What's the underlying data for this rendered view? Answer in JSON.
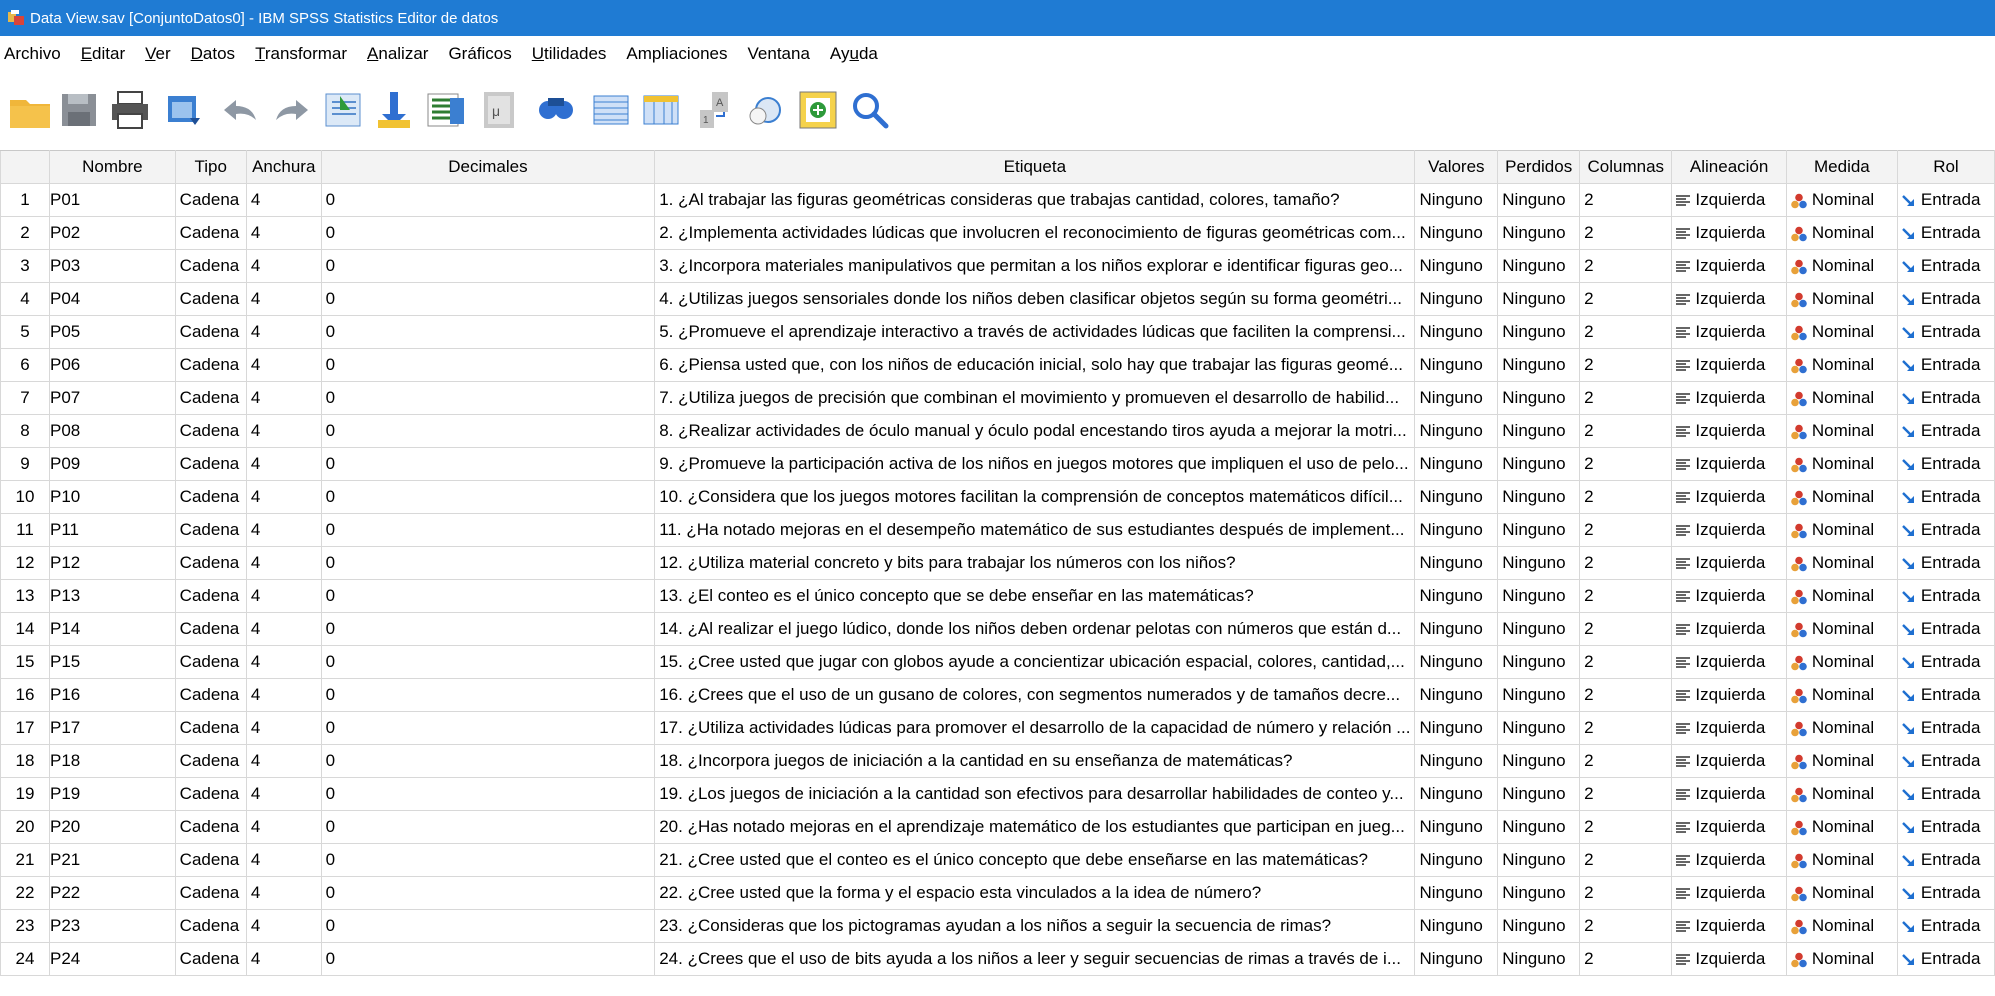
{
  "window": {
    "title": "Data View.sav [ConjuntoDatos0] - IBM SPSS Statistics Editor de datos"
  },
  "menu": [
    {
      "label": "Archivo",
      "accel": ""
    },
    {
      "label": "Editar",
      "accel": "E"
    },
    {
      "label": "Ver",
      "accel": "V"
    },
    {
      "label": "Datos",
      "accel": "D"
    },
    {
      "label": "Transformar",
      "accel": "T"
    },
    {
      "label": "Analizar",
      "accel": "A"
    },
    {
      "label": "Gráficos",
      "accel": ""
    },
    {
      "label": "Utilidades",
      "accel": "U"
    },
    {
      "label": "Ampliaciones",
      "accel": ""
    },
    {
      "label": "Ventana",
      "accel": ""
    },
    {
      "label": "Ayuda",
      "accel": "u"
    }
  ],
  "toolbar": [
    "open-folder-icon",
    "save-icon",
    "print-icon",
    "dialog-recall-icon",
    "undo-icon",
    "redo-icon",
    "go-to-case-icon",
    "go-to-variable-icon",
    "variables-icon",
    "run-descriptives-icon",
    "find-icon",
    "insert-cases-icon",
    "insert-variable-icon",
    "split-file-icon",
    "weight-cases-icon",
    "select-cases-icon",
    "search-icon"
  ],
  "colors": {
    "titlebar": "#1f7bd3",
    "header": "#f3f3f3",
    "nominal_red": "#c0392b",
    "entrada_blue": "#1e6fd0"
  },
  "grid": {
    "headers": [
      "Nombre",
      "Tipo",
      "Anchura",
      "Decimales",
      "Etiqueta",
      "Valores",
      "Perdidos",
      "Columnas",
      "Alineación",
      "Medida",
      "Rol"
    ],
    "rows": [
      {
        "n": "1",
        "nombre": "P01",
        "tipo": "Cadena",
        "anchura": "4",
        "decimales": "0",
        "etiqueta": "1. ¿Al trabajar las figuras geométricas consideras que trabajas cantidad, colores, tamaño?",
        "valores": "Ninguno",
        "perdidos": "Ninguno",
        "columnas": "2",
        "alineacion": "Izquierda",
        "medida": "Nominal",
        "rol": "Entrada"
      },
      {
        "n": "2",
        "nombre": "P02",
        "tipo": "Cadena",
        "anchura": "4",
        "decimales": "0",
        "etiqueta": "2. ¿Implementa actividades lúdicas que involucren el reconocimiento de figuras geométricas com...",
        "valores": "Ninguno",
        "perdidos": "Ninguno",
        "columnas": "2",
        "alineacion": "Izquierda",
        "medida": "Nominal",
        "rol": "Entrada"
      },
      {
        "n": "3",
        "nombre": "P03",
        "tipo": "Cadena",
        "anchura": "4",
        "decimales": "0",
        "etiqueta": "3. ¿Incorpora materiales manipulativos que permitan a los niños explorar e identificar figuras geo...",
        "valores": "Ninguno",
        "perdidos": "Ninguno",
        "columnas": "2",
        "alineacion": "Izquierda",
        "medida": "Nominal",
        "rol": "Entrada"
      },
      {
        "n": "4",
        "nombre": "P04",
        "tipo": "Cadena",
        "anchura": "4",
        "decimales": "0",
        "etiqueta": "4. ¿Utilizas juegos sensoriales donde los niños deben clasificar objetos según su forma geométri...",
        "valores": "Ninguno",
        "perdidos": "Ninguno",
        "columnas": "2",
        "alineacion": "Izquierda",
        "medida": "Nominal",
        "rol": "Entrada"
      },
      {
        "n": "5",
        "nombre": "P05",
        "tipo": "Cadena",
        "anchura": "4",
        "decimales": "0",
        "etiqueta": "5. ¿Promueve el aprendizaje interactivo a través de actividades lúdicas que faciliten la comprensi...",
        "valores": "Ninguno",
        "perdidos": "Ninguno",
        "columnas": "2",
        "alineacion": "Izquierda",
        "medida": "Nominal",
        "rol": "Entrada"
      },
      {
        "n": "6",
        "nombre": "P06",
        "tipo": "Cadena",
        "anchura": "4",
        "decimales": "0",
        "etiqueta": "6. ¿Piensa usted que, con los niños de educación inicial, solo hay que trabajar las figuras geomé...",
        "valores": "Ninguno",
        "perdidos": "Ninguno",
        "columnas": "2",
        "alineacion": "Izquierda",
        "medida": "Nominal",
        "rol": "Entrada"
      },
      {
        "n": "7",
        "nombre": "P07",
        "tipo": "Cadena",
        "anchura": "4",
        "decimales": "0",
        "etiqueta": "7. ¿Utiliza juegos de precisión que combinan el movimiento   y promueven el desarrollo de habilid...",
        "valores": "Ninguno",
        "perdidos": "Ninguno",
        "columnas": "2",
        "alineacion": "Izquierda",
        "medida": "Nominal",
        "rol": "Entrada"
      },
      {
        "n": "8",
        "nombre": "P08",
        "tipo": "Cadena",
        "anchura": "4",
        "decimales": "0",
        "etiqueta": "8. ¿Realizar actividades de óculo manual y óculo podal encestando tiros ayuda a mejorar la motri...",
        "valores": "Ninguno",
        "perdidos": "Ninguno",
        "columnas": "2",
        "alineacion": "Izquierda",
        "medida": "Nominal",
        "rol": "Entrada"
      },
      {
        "n": "9",
        "nombre": "P09",
        "tipo": "Cadena",
        "anchura": "4",
        "decimales": "0",
        "etiqueta": "9. ¿Promueve la participación activa de los niños en juegos motores que impliquen el uso de pelo...",
        "valores": "Ninguno",
        "perdidos": "Ninguno",
        "columnas": "2",
        "alineacion": "Izquierda",
        "medida": "Nominal",
        "rol": "Entrada"
      },
      {
        "n": "10",
        "nombre": "P10",
        "tipo": "Cadena",
        "anchura": "4",
        "decimales": "0",
        "etiqueta": "10. ¿Considera que los juegos motores facilitan la comprensión de conceptos matemáticos difícil...",
        "valores": "Ninguno",
        "perdidos": "Ninguno",
        "columnas": "2",
        "alineacion": "Izquierda",
        "medida": "Nominal",
        "rol": "Entrada"
      },
      {
        "n": "11",
        "nombre": "P11",
        "tipo": "Cadena",
        "anchura": "4",
        "decimales": "0",
        "etiqueta": "11. ¿Ha notado mejoras en el desempeño matemático de sus estudiantes después de implement...",
        "valores": "Ninguno",
        "perdidos": "Ninguno",
        "columnas": "2",
        "alineacion": "Izquierda",
        "medida": "Nominal",
        "rol": "Entrada"
      },
      {
        "n": "12",
        "nombre": "P12",
        "tipo": "Cadena",
        "anchura": "4",
        "decimales": "0",
        "etiqueta": "12. ¿Utiliza material concreto y bits para trabajar los números con los niños?",
        "valores": "Ninguno",
        "perdidos": "Ninguno",
        "columnas": "2",
        "alineacion": "Izquierda",
        "medida": "Nominal",
        "rol": "Entrada"
      },
      {
        "n": "13",
        "nombre": "P13",
        "tipo": "Cadena",
        "anchura": "4",
        "decimales": "0",
        "etiqueta": "13. ¿El conteo es el único concepto que se debe enseñar en las matemáticas?",
        "valores": "Ninguno",
        "perdidos": "Ninguno",
        "columnas": "2",
        "alineacion": "Izquierda",
        "medida": "Nominal",
        "rol": "Entrada"
      },
      {
        "n": "14",
        "nombre": "P14",
        "tipo": "Cadena",
        "anchura": "4",
        "decimales": "0",
        "etiqueta": "14. ¿Al realizar el juego lúdico, donde los niños deben ordenar pelotas con números que están d...",
        "valores": "Ninguno",
        "perdidos": "Ninguno",
        "columnas": "2",
        "alineacion": "Izquierda",
        "medida": "Nominal",
        "rol": "Entrada"
      },
      {
        "n": "15",
        "nombre": "P15",
        "tipo": "Cadena",
        "anchura": "4",
        "decimales": "0",
        "etiqueta": "15. ¿Cree usted que jugar con globos ayude a concientizar ubicación espacial, colores, cantidad,...",
        "valores": "Ninguno",
        "perdidos": "Ninguno",
        "columnas": "2",
        "alineacion": "Izquierda",
        "medida": "Nominal",
        "rol": "Entrada"
      },
      {
        "n": "16",
        "nombre": "P16",
        "tipo": "Cadena",
        "anchura": "4",
        "decimales": "0",
        "etiqueta": "16. ¿Crees que el uso de un gusano de colores, con segmentos numerados y de tamaños decre...",
        "valores": "Ninguno",
        "perdidos": "Ninguno",
        "columnas": "2",
        "alineacion": "Izquierda",
        "medida": "Nominal",
        "rol": "Entrada"
      },
      {
        "n": "17",
        "nombre": "P17",
        "tipo": "Cadena",
        "anchura": "4",
        "decimales": "0",
        "etiqueta": "17. ¿Utiliza actividades lúdicas para promover el desarrollo de la capacidad de número y relación ...",
        "valores": "Ninguno",
        "perdidos": "Ninguno",
        "columnas": "2",
        "alineacion": "Izquierda",
        "medida": "Nominal",
        "rol": "Entrada"
      },
      {
        "n": "18",
        "nombre": "P18",
        "tipo": "Cadena",
        "anchura": "4",
        "decimales": "0",
        "etiqueta": "18. ¿Incorpora juegos de iniciación a la cantidad en su enseñanza de matemáticas?",
        "valores": "Ninguno",
        "perdidos": "Ninguno",
        "columnas": "2",
        "alineacion": "Izquierda",
        "medida": "Nominal",
        "rol": "Entrada"
      },
      {
        "n": "19",
        "nombre": "P19",
        "tipo": "Cadena",
        "anchura": "4",
        "decimales": "0",
        "etiqueta": "19. ¿Los juegos de iniciación a la cantidad son efectivos para desarrollar habilidades de conteo y...",
        "valores": "Ninguno",
        "perdidos": "Ninguno",
        "columnas": "2",
        "alineacion": "Izquierda",
        "medida": "Nominal",
        "rol": "Entrada"
      },
      {
        "n": "20",
        "nombre": "P20",
        "tipo": "Cadena",
        "anchura": "4",
        "decimales": "0",
        "etiqueta": "20. ¿Has notado mejoras en el aprendizaje matemático de los estudiantes que participan en jueg...",
        "valores": "Ninguno",
        "perdidos": "Ninguno",
        "columnas": "2",
        "alineacion": "Izquierda",
        "medida": "Nominal",
        "rol": "Entrada"
      },
      {
        "n": "21",
        "nombre": "P21",
        "tipo": "Cadena",
        "anchura": "4",
        "decimales": "0",
        "etiqueta": "21. ¿Cree usted que el conteo es el único concepto que debe enseñarse en las matemáticas?",
        "valores": "Ninguno",
        "perdidos": "Ninguno",
        "columnas": "2",
        "alineacion": "Izquierda",
        "medida": "Nominal",
        "rol": "Entrada"
      },
      {
        "n": "22",
        "nombre": "P22",
        "tipo": "Cadena",
        "anchura": "4",
        "decimales": "0",
        "etiqueta": "22. ¿Cree usted que la forma y el espacio esta vinculados a la idea de número?",
        "valores": "Ninguno",
        "perdidos": "Ninguno",
        "columnas": "2",
        "alineacion": "Izquierda",
        "medida": "Nominal",
        "rol": "Entrada"
      },
      {
        "n": "23",
        "nombre": "P23",
        "tipo": "Cadena",
        "anchura": "4",
        "decimales": "0",
        "etiqueta": "23. ¿Consideras que los pictogramas ayudan a los niños a seguir la secuencia de rimas?",
        "valores": "Ninguno",
        "perdidos": "Ninguno",
        "columnas": "2",
        "alineacion": "Izquierda",
        "medida": "Nominal",
        "rol": "Entrada"
      },
      {
        "n": "24",
        "nombre": "P24",
        "tipo": "Cadena",
        "anchura": "4",
        "decimales": "0",
        "etiqueta": "24. ¿Crees que el uso de bits ayuda a los niños a leer y seguir secuencias de rimas a través de i...",
        "valores": "Ninguno",
        "perdidos": "Ninguno",
        "columnas": "2",
        "alineacion": "Izquierda",
        "medida": "Nominal",
        "rol": "Entrada"
      }
    ]
  }
}
